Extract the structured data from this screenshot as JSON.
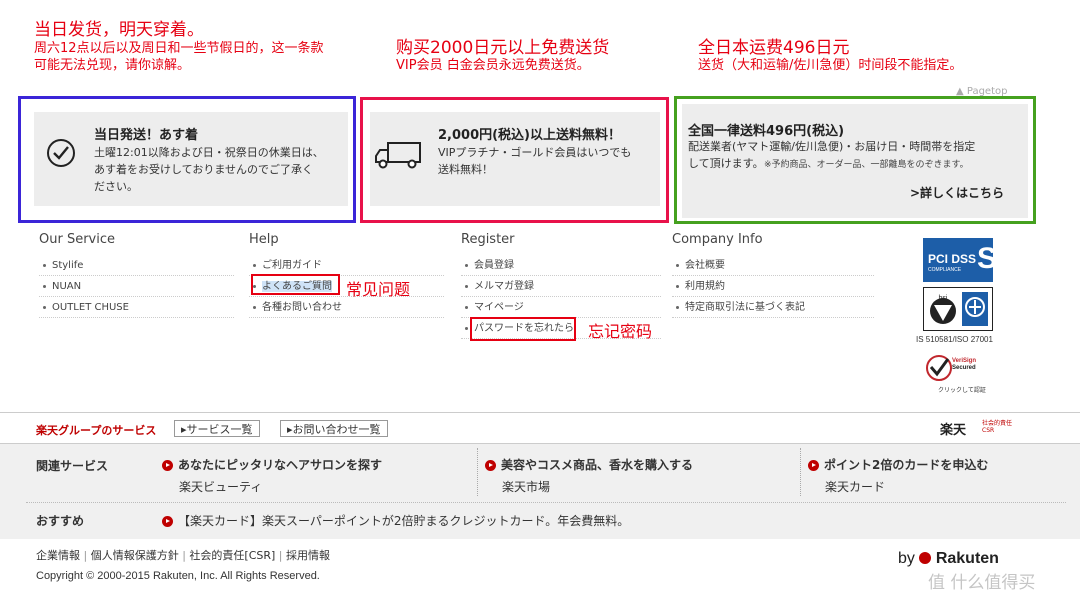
{
  "annotations": {
    "note1_title": "当日发货，明天穿着。",
    "note1_line1": "周六12点以后以及周日和一些节假日的，这一条款",
    "note1_line2": "可能无法兑现，请你谅解。",
    "note2_title": "购买2000日元以上免费送货",
    "note2_line1": "VIP会员 白金会员永远免费送货。",
    "note3_title": "全日本运费496日元",
    "note3_line1": "送货（大和运输/佐川急便）时间段不能指定。",
    "faq_label": "常见问题",
    "password_label": "忘记密码"
  },
  "pagetop": "Pagetop",
  "panels": {
    "sameday": {
      "title": "当日発送！あす着",
      "lines": [
        "土曜12:01以降および日・祝祭日の休業日は、",
        "あす着をお受けしておりませんのでご了承く",
        "ださい。"
      ]
    },
    "freeship": {
      "title": "2,000円(税込)以上送料無料！",
      "lines": [
        "VIPプラチナ・ゴールド会員はいつでも",
        "送料無料！"
      ]
    },
    "flatrate": {
      "title": "全国一律送料496円(税込)",
      "lines": [
        "配送業者(ヤマト運輸/佐川急便)・お届け日・時間帯を指定",
        "して頂けます。"
      ],
      "small": "※予約商品、オーダー品、一部離島をのぞきます。",
      "link": ">詳しくはこちら"
    }
  },
  "footer_cols": {
    "service": {
      "heading": "Our Service",
      "items": [
        "Stylife",
        "NUAN",
        "OUTLET CHUSE"
      ]
    },
    "help": {
      "heading": "Help",
      "items": [
        "ご利用ガイド",
        "よくあるご質問",
        "各種お問い合わせ"
      ]
    },
    "register": {
      "heading": "Register",
      "items": [
        "会員登録",
        "メルマガ登録",
        "マイページ",
        "パスワードを忘れたら"
      ]
    },
    "company": {
      "heading": "Company Info",
      "items": [
        "会社概要",
        "利用規約",
        "特定商取引法に基づく表記"
      ]
    }
  },
  "badges": {
    "pci_text": "PCI DSS",
    "pci_sub": "COMPLIANCE",
    "iso_text": "IS 510581/ISO 27001",
    "verisign_line1": "VeriSign",
    "verisign_line2": "Secured",
    "verisign_caption": "クリックして認証"
  },
  "rakuten_group": {
    "title": "楽天グループのサービス",
    "btn_services": "サービス一覧",
    "btn_contact": "お問い合わせ一覧",
    "csr_logo": "楽天",
    "csr_sub1": "社会的責任",
    "csr_sub2": "CSR",
    "related_label": "関連サービス",
    "related": [
      {
        "headline": "あなたにピッタリなヘアサロンを探す",
        "sub": "楽天ビューティ"
      },
      {
        "headline": "美容やコスメ商品、香水を購入する",
        "sub": "楽天市場"
      },
      {
        "headline": "ポイント2倍のカードを申込む",
        "sub": "楽天カード"
      }
    ],
    "recommend_label": "おすすめ",
    "recommend_text": "【楽天カード】楽天スーパーポイントが2倍貯まるクレジットカード。年会費無料。"
  },
  "bottom": {
    "links": [
      "企業情報",
      "個人情報保護方針",
      "社会的責任[CSR]",
      "採用情報"
    ],
    "copyright": "Copyright © 2000-2015 Rakuten, Inc. All Rights Reserved.",
    "by_rakuten_by": "by",
    "by_rakuten_name": "Rakuten",
    "watermark": "值 什么值得买"
  },
  "colors": {
    "annotation_red": "#e60012",
    "outline_blue": "#3b25d8",
    "outline_pink": "#e8124a",
    "outline_green": "#45a11f",
    "rakuten_red": "#bf0000"
  }
}
